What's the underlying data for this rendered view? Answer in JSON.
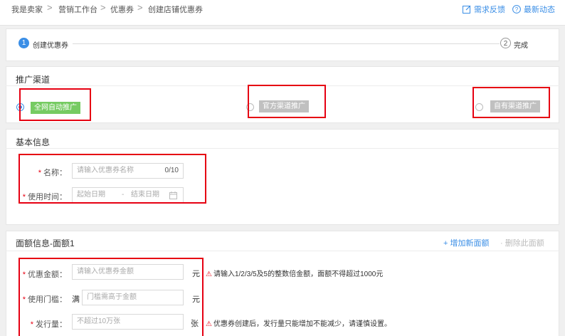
{
  "breadcrumb": [
    "我是卖家",
    "营销工作台",
    "优惠券",
    "创建店铺优惠券"
  ],
  "breadcrumb_sep": ">",
  "toplinks": {
    "feedback": "需求反馈",
    "news": "最新动态"
  },
  "steps": [
    {
      "num": "1",
      "label": "创建优惠券"
    },
    {
      "num": "2",
      "label": "完成"
    }
  ],
  "channel": {
    "title": "推广渠道",
    "options": [
      "全网自动推广",
      "官方渠道推广",
      "自有渠道推广"
    ],
    "selected": "全网自动推广"
  },
  "basic": {
    "title": "基本信息",
    "name_label": "名称：",
    "name_placeholder": "请输入优惠券名称",
    "name_count": "0/10",
    "time_label": "使用时间：",
    "start_placeholder": "起始日期",
    "dash": "-",
    "end_placeholder": "结束日期"
  },
  "face": {
    "title": "面额信息-面额1",
    "add": "+ 增加新面额",
    "delete": "· 删除此面额",
    "amount_label": "优惠金额：",
    "amount_placeholder": "请输入优惠券金额",
    "amount_unit": "元",
    "amount_tip": "请输入1/2/3/5及5的整数倍金额，面额不得超过1000元",
    "threshold_label": "使用门槛：",
    "threshold_prefix": "满",
    "threshold_placeholder": "门槛需高于金额",
    "threshold_unit": "元",
    "qty_label": "发行量：",
    "qty_placeholder": "不超过10万张",
    "qty_unit": "张",
    "qty_tip": "优惠券创建后，发行量只能增加不能减少，请谨慎设置。"
  },
  "colors": {
    "accent": "#3a8ee6",
    "highlight": "#e60012",
    "green_tag": "#76cb62"
  }
}
